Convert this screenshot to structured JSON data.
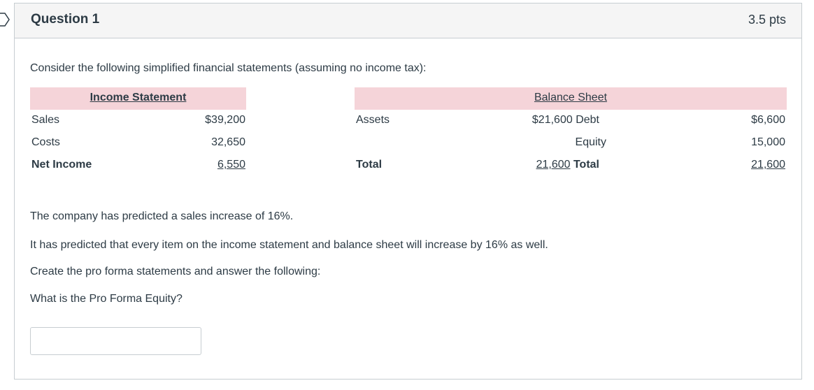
{
  "question": {
    "title": "Question 1",
    "points": "3.5 pts",
    "intro": "Consider the following simplified financial statements (assuming no income tax):",
    "p1": "The company has predicted a sales increase of 16%.",
    "p2": "It has predicted that every item on the income statement and balance sheet will increase by 16% as well.",
    "p3": "Create the pro forma statements and answer the following:",
    "p4": "What is the Pro Forma Equity?",
    "answer_value": ""
  },
  "income": {
    "header": "Income Statement",
    "sales_label": "Sales",
    "sales_value": "$39,200",
    "costs_label": "Costs",
    "costs_value": "32,650",
    "net_label": "Net Income",
    "net_value": "6,550"
  },
  "balance": {
    "header": "Balance Sheet",
    "assets_label": "Assets",
    "assets_value": "$21,600",
    "debt_label": "Debt",
    "debt_value": "$6,600",
    "equity_label": "Equity",
    "equity_value": "15,000",
    "total_label": "Total",
    "total_assets_value": "21,600",
    "total_right_label": "Total",
    "total_value": "21,600"
  },
  "colors": {
    "header_band": "#f5d4d9",
    "border": "#c7cdd1",
    "text": "#2d3b45"
  }
}
